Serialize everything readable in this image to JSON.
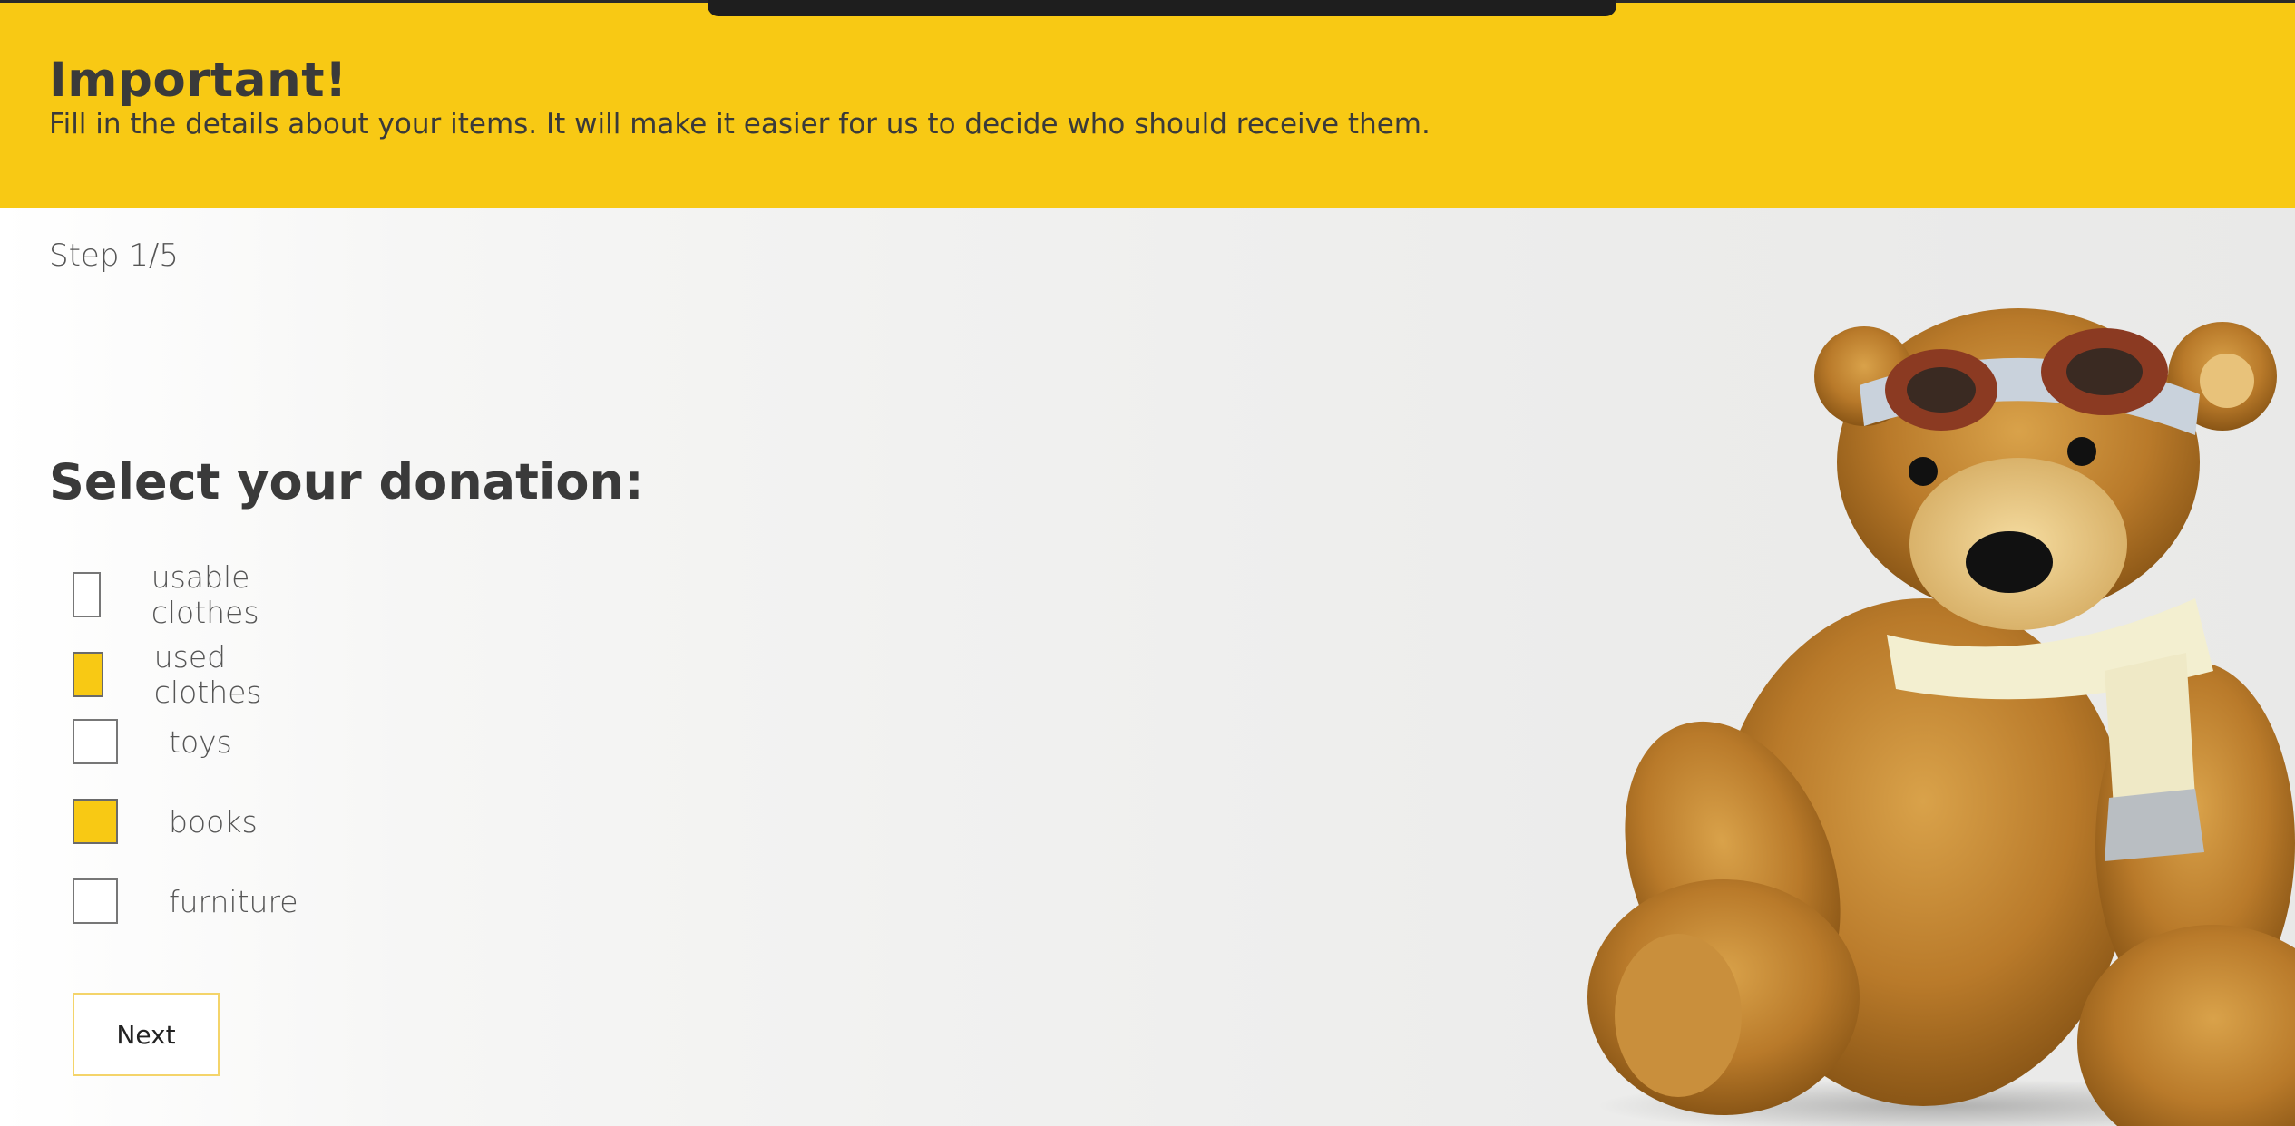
{
  "banner": {
    "title": "Important!",
    "text": "Fill in the details about your items. It will make it easier for us to decide who should receive them."
  },
  "step": {
    "label": "Step 1/5"
  },
  "form": {
    "heading": "Select your donation:",
    "options": [
      {
        "label": "usable clothes",
        "checked": false
      },
      {
        "label": "used clothes",
        "checked": true
      },
      {
        "label": "toys",
        "checked": false
      },
      {
        "label": "books",
        "checked": true
      },
      {
        "label": "furniture",
        "checked": false
      }
    ],
    "next_label": "Next"
  },
  "colors": {
    "accent": "#f8c914",
    "text": "#3a3a3a"
  }
}
